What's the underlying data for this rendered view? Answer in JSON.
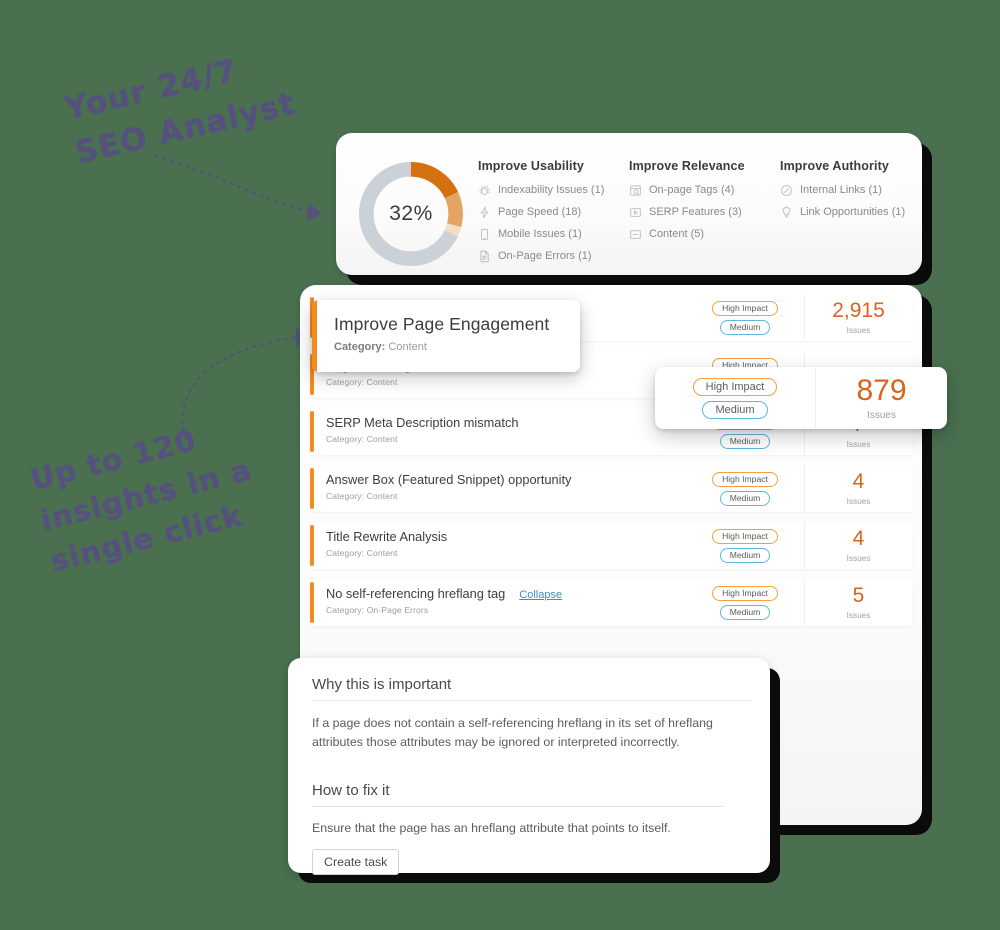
{
  "annotations": [
    {
      "id": "a1",
      "text": "Your 24/7\nSEO Analyst"
    },
    {
      "id": "a2",
      "text": "Up to 120\ninsights in a\nsingle click"
    }
  ],
  "summary": {
    "score": "32%",
    "donut": {
      "segments": [
        {
          "name": "dark-orange",
          "percent": 18,
          "color": "#d4700f"
        },
        {
          "name": "light-orange",
          "percent": 11,
          "color": "#e3a464"
        },
        {
          "name": "pale-tan",
          "percent": 3,
          "color": "#f2dfc6"
        },
        {
          "name": "grey-remainder",
          "percent": 68,
          "color": "#ccd0d7"
        }
      ]
    },
    "columns": [
      {
        "title": "Improve Usability",
        "items": [
          {
            "icon": "bug-icon",
            "label": "Indexability Issues (1)"
          },
          {
            "icon": "lightning-icon",
            "label": "Page Speed (18)"
          },
          {
            "icon": "mobile-icon",
            "label": "Mobile Issues (1)"
          },
          {
            "icon": "document-icon",
            "label": "On-Page Errors (1)"
          }
        ]
      },
      {
        "title": "Improve Relevance",
        "items": [
          {
            "icon": "tag-search-icon",
            "label": "On-page Tags (4)"
          },
          {
            "icon": "serp-play-icon",
            "label": "SERP Features (3)"
          },
          {
            "icon": "content-box-icon",
            "label": "Content (5)"
          }
        ]
      },
      {
        "title": "Improve Authority",
        "items": [
          {
            "icon": "link-circle-icon",
            "label": "Internal Links (1)"
          },
          {
            "icon": "lightbulb-icon",
            "label": "Link Opportunities (1)"
          }
        ]
      }
    ]
  },
  "engagement_popup": {
    "title": "Improve Page Engagement",
    "category_label": "Category:",
    "category_value": "Content"
  },
  "count_popup": {
    "impact": "High Impact",
    "severity": "Medium",
    "count": "879",
    "count_label": "Issues"
  },
  "list": {
    "rows": [
      {
        "title": "",
        "category": "",
        "link": "",
        "impact": "High Impact",
        "severity": "Medium",
        "count": "2,915",
        "count_label": "Issues"
      },
      {
        "title": "Pages needing content refresh",
        "category": "Category: Content",
        "link": "",
        "impact": "High Impact",
        "severity": "Medium",
        "count": "",
        "count_label": ""
      },
      {
        "title": "SERP Meta Description mismatch",
        "category": "Category: Content",
        "link": "",
        "impact": "High Impact",
        "severity": "Medium",
        "count": "7",
        "count_label": "Issues"
      },
      {
        "title": "Answer Box (Featured Snippet) opportunity",
        "category": "Category: Content",
        "link": "",
        "impact": "High Impact",
        "severity": "Medium",
        "count": "4",
        "count_label": "Issues"
      },
      {
        "title": "Title Rewrite Analysis",
        "category": "Category: Content",
        "link": "",
        "impact": "High Impact",
        "severity": "Medium",
        "count": "4",
        "count_label": "Issues"
      },
      {
        "title": "No self-referencing hreflang tag",
        "category": "Category: On-Page Errors",
        "link": "Collapse",
        "impact": "High Impact",
        "severity": "Medium",
        "count": "5",
        "count_label": "Issues"
      }
    ]
  },
  "detail": {
    "why_heading": "Why this is important",
    "why_text": "If a page does not contain a self-referencing hreflang in its set of hreflang attributes those attributes may be ignored or interpreted incorrectly.",
    "fix_heading": "How to fix it",
    "fix_text": "Ensure that the page has an hreflang attribute that points to itself.",
    "create_task": "Create task"
  },
  "colors": {
    "background": "#4a7050",
    "accent_orange": "#f28c1e",
    "count_orange": "#d9641d",
    "badge_impact_border": "#f0a13c",
    "badge_severity_border": "#5fb6dd",
    "link_blue": "#3d8fc4",
    "handwriting": "#55507e"
  }
}
